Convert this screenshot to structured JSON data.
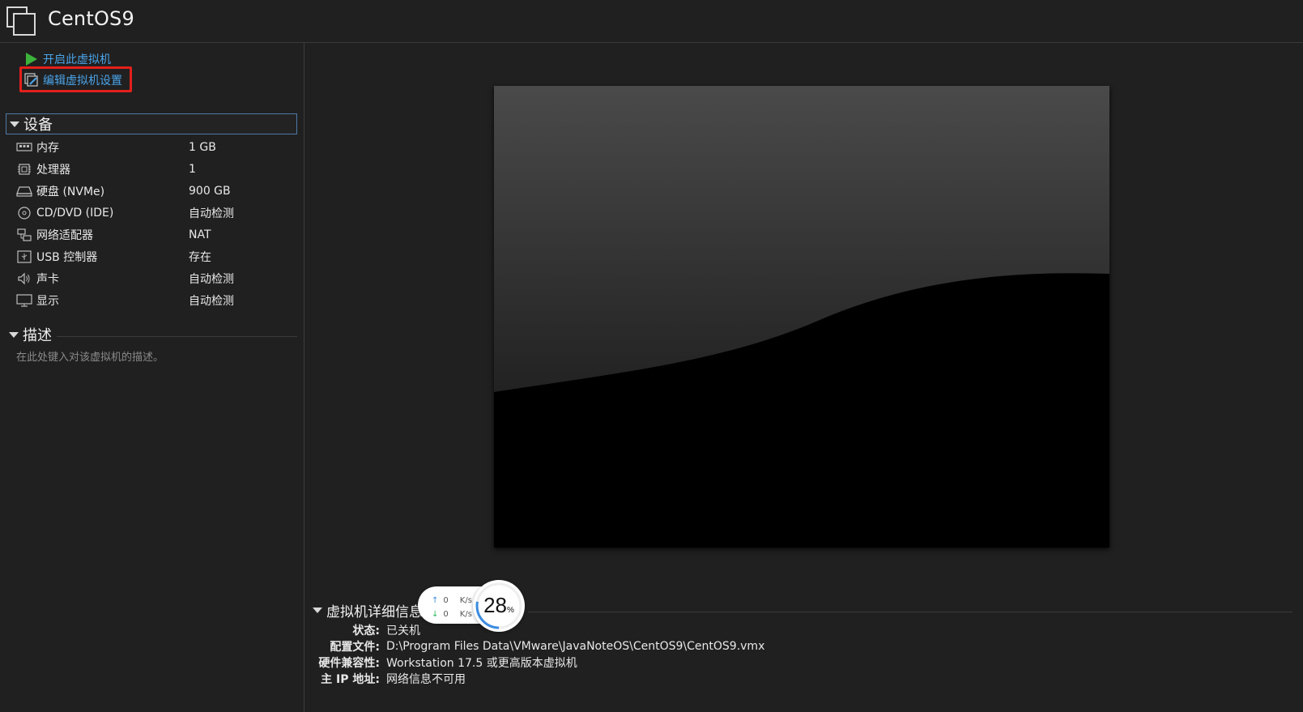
{
  "window": {
    "title": "CentOS9"
  },
  "commands": {
    "start": "开启此虚拟机",
    "edit_settings": "编辑虚拟机设置"
  },
  "devices": {
    "header": "设备",
    "items": [
      {
        "icon": "memory-icon",
        "name": "内存",
        "value": "1 GB"
      },
      {
        "icon": "processor-icon",
        "name": "处理器",
        "value": "1"
      },
      {
        "icon": "hard-disk-icon",
        "name": "硬盘 (NVMe)",
        "value": "900 GB"
      },
      {
        "icon": "cd-dvd-icon",
        "name": "CD/DVD (IDE)",
        "value": "自动检测"
      },
      {
        "icon": "network-adapter-icon",
        "name": "网络适配器",
        "value": "NAT"
      },
      {
        "icon": "usb-controller-icon",
        "name": "USB 控制器",
        "value": "存在"
      },
      {
        "icon": "sound-card-icon",
        "name": "声卡",
        "value": "自动检测"
      },
      {
        "icon": "display-icon",
        "name": "显示",
        "value": "自动检测"
      }
    ]
  },
  "description": {
    "header": "描述",
    "placeholder": "在此处键入对该虚拟机的描述。"
  },
  "details": {
    "header": "虚拟机详细信息",
    "rows": [
      {
        "label": "状态:",
        "value": "已关机"
      },
      {
        "label": "配置文件:",
        "value": "D:\\Program Files Data\\VMware\\JavaNoteOS\\CentOS9\\CentOS9.vmx"
      },
      {
        "label": "硬件兼容性:",
        "value": "Workstation 17.5 或更高版本虚拟机"
      },
      {
        "label": "主 IP 地址:",
        "value": "网络信息不可用"
      }
    ]
  },
  "net_widget": {
    "upload_value": "0",
    "upload_unit": "K/s",
    "download_value": "0",
    "download_unit": "K/s",
    "percent": "28",
    "percent_sign": "%",
    "percent_fraction": 0.28
  },
  "colors": {
    "link": "#4aa3e8",
    "highlight": "#e3201b",
    "background": "#202020"
  }
}
